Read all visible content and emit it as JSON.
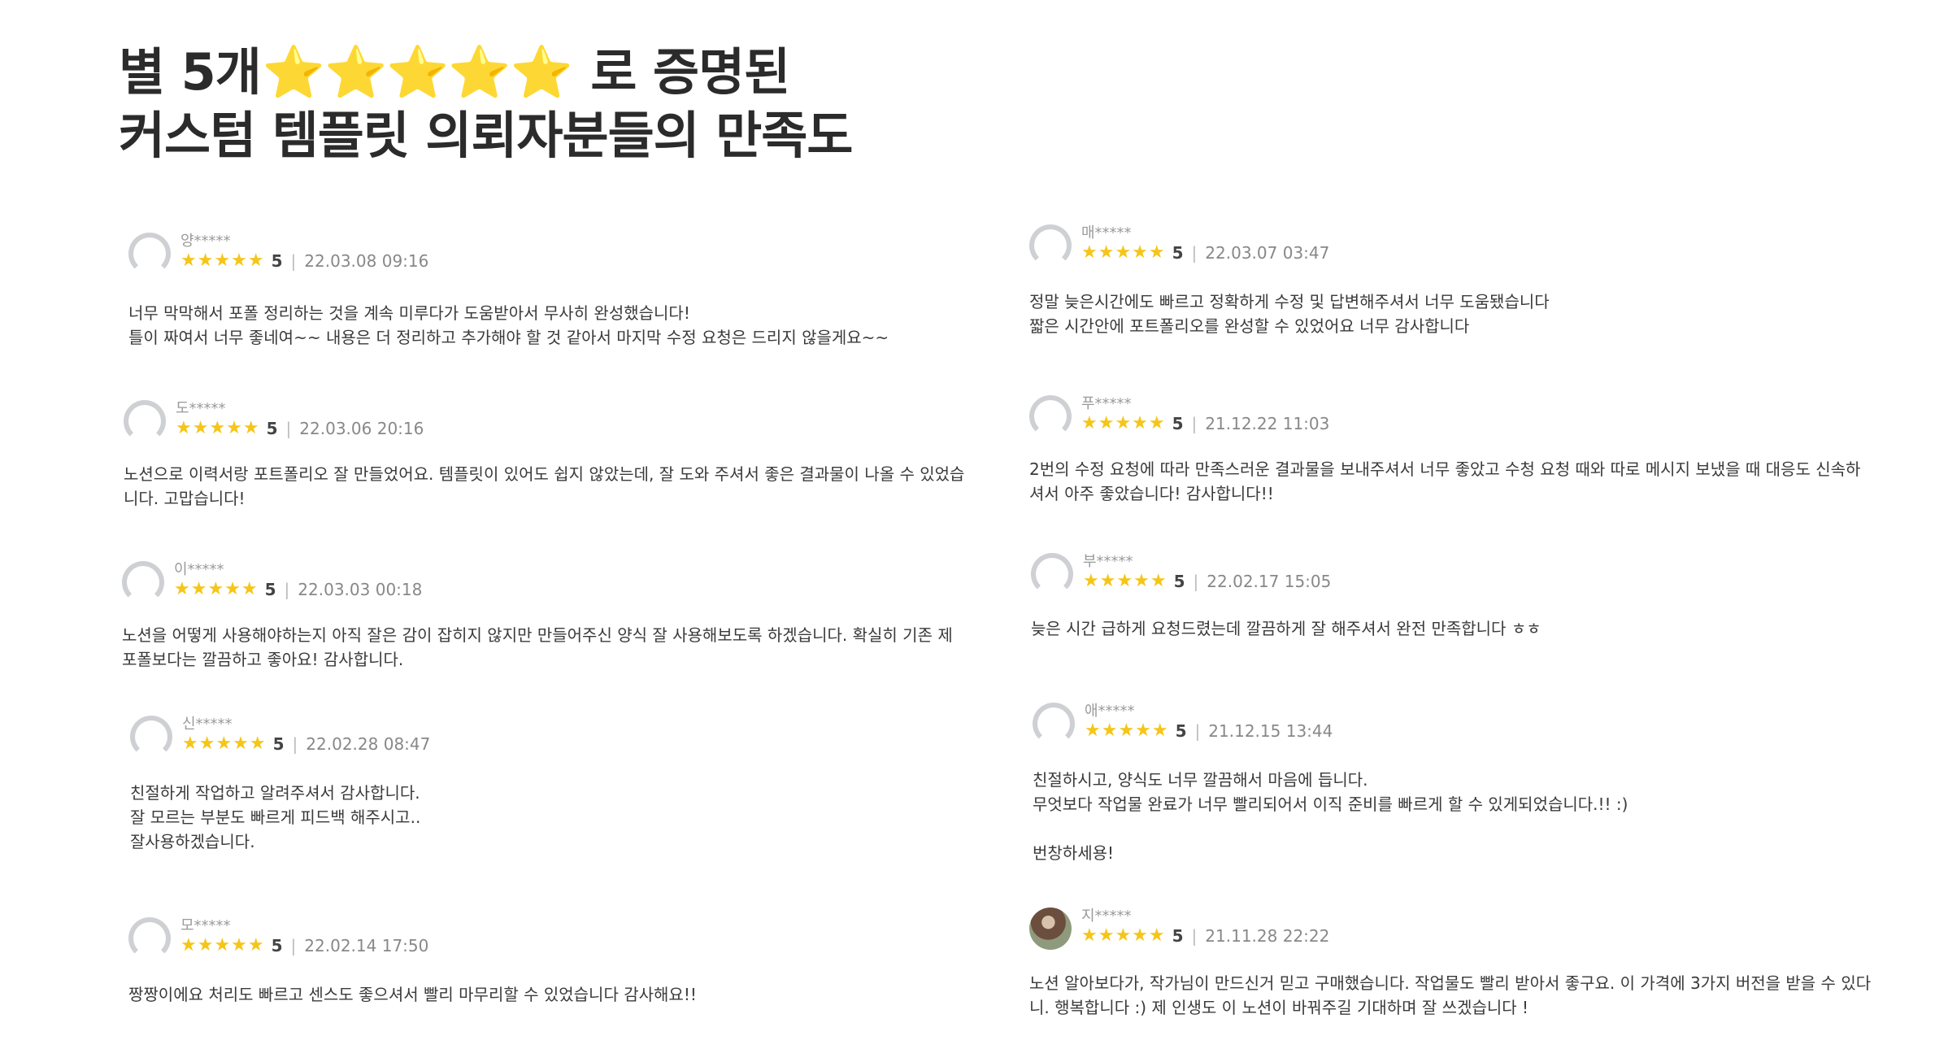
{
  "headline": {
    "line1_prefix": "별 5개",
    "line1_stars": "⭐⭐⭐⭐⭐",
    "line1_suffix": " 로 증명된",
    "line2": "커스텀 템플릿 의뢰자분들의 만족도"
  },
  "reviews_left": [
    {
      "user": "양*****",
      "stars": "★★★★★",
      "score": "5",
      "sep": "|",
      "date": "22.03.08 09:16",
      "lines": [
        "너무 막막해서 포폴 정리하는 것을 계속 미루다가 도움받아서 무사히 완성했습니다!",
        "틀이 짜여서 너무 좋네여~~ 내용은 더 정리하고 추가해야 할 것 같아서 마지막 수정 요청은 드리지 않을게요~~"
      ]
    },
    {
      "user": "도*****",
      "stars": "★★★★★",
      "score": "5",
      "sep": "|",
      "date": "22.03.06 20:16",
      "lines": [
        "노션으로 이력서랑 포트폴리오 잘 만들었어요. 템플릿이 있어도 쉽지 않았는데, 잘 도와 주셔서 좋은 결과물이 나올 수 있었습",
        "니다. 고맙습니다!"
      ]
    },
    {
      "user": "이*****",
      "stars": "★★★★★",
      "score": "5",
      "sep": "|",
      "date": "22.03.03 00:18",
      "lines": [
        "노션을 어떻게 사용해야하는지 아직 잘은 감이 잡히지 않지만 만들어주신 양식 잘 사용해보도록 하겠습니다. 확실히 기존 제",
        "포폴보다는 깔끔하고 좋아요! 감사합니다."
      ]
    },
    {
      "user": "신*****",
      "stars": "★★★★★",
      "score": "5",
      "sep": "|",
      "date": "22.02.28 08:47",
      "lines": [
        "친절하게 작업하고 알려주셔서 감사합니다.",
        "잘 모르는 부분도 빠르게 피드백 해주시고..",
        "잘사용하겠습니다."
      ]
    },
    {
      "user": "모*****",
      "stars": "★★★★★",
      "score": "5",
      "sep": "|",
      "date": "22.02.14 17:50",
      "lines": [
        "짱짱이에요 처리도 빠르고 센스도 좋으셔서 빨리 마무리할 수 있었습니다 감사해요!!"
      ]
    }
  ],
  "reviews_right": [
    {
      "user": "매*****",
      "stars": "★★★★★",
      "score": "5",
      "sep": "|",
      "date": "22.03.07 03:47",
      "lines": [
        "정말 늦은시간에도 빠르고 정확하게 수정 및 답변해주셔서 너무 도움됐습니다",
        "짧은 시간안에 포트폴리오를 완성할 수 있었어요 너무 감사합니다"
      ]
    },
    {
      "user": "푸*****",
      "stars": "★★★★★",
      "score": "5",
      "sep": "|",
      "date": "21.12.22 11:03",
      "lines": [
        "2번의 수정 요청에 따라 만족스러운 결과물을 보내주셔서 너무 좋았고 수청 요청 때와 따로 메시지 보냈을 때 대응도 신속하",
        "셔서 아주 좋았습니다! 감사합니다!!"
      ]
    },
    {
      "user": "부*****",
      "stars": "★★★★★",
      "score": "5",
      "sep": "|",
      "date": "22.02.17 15:05",
      "lines": [
        "늦은 시간 급하게 요청드렸는데 깔끔하게 잘 해주셔서 완전 만족합니다 ㅎㅎ"
      ]
    },
    {
      "user": "애*****",
      "stars": "★★★★★",
      "score": "5",
      "sep": "|",
      "date": "21.12.15 13:44",
      "lines": [
        "친절하시고, 양식도 너무 깔끔해서 마음에 듭니다.",
        "무엇보다 작업물 완료가 너무 빨리되어서 이직 준비를 빠르게 할 수 있게되었습니다.!! :)",
        "",
        "번창하세용!"
      ]
    },
    {
      "user": "지*****",
      "stars": "★★★★★",
      "score": "5",
      "sep": "|",
      "date": "21.11.28 22:22",
      "lines": [
        "노션 알아보다가, 작가님이 만드신거 믿고 구매했습니다. 작업물도 빨리 받아서 좋구요. 이 가격에 3가지 버전을 받을 수 있다",
        "니. 행복합니다 :) 제 인생도 이 노션이 바꿔주길 기대하며 잘 쓰겠습니다 !"
      ]
    }
  ]
}
